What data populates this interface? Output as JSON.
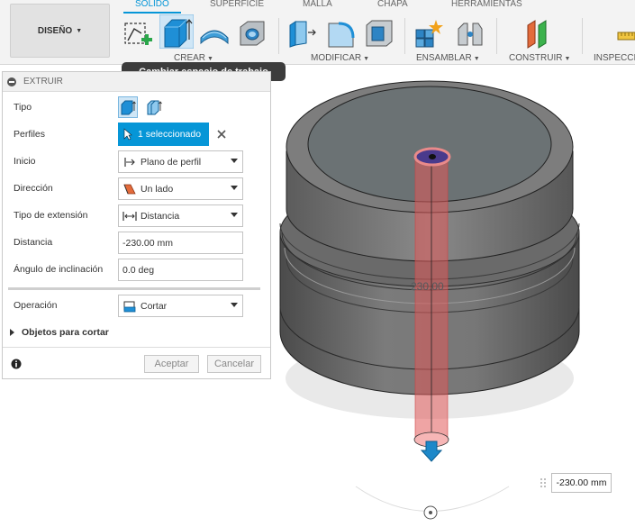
{
  "toolbar": {
    "workspace_label": "DISEÑO",
    "tabs": [
      "SÓLIDO",
      "SUPERFICIE",
      "MALLA",
      "CHAPA",
      "HERRAMIENTAS"
    ],
    "groups": {
      "create": "CREAR",
      "modify": "MODIFICAR",
      "assemble": "ENSAMBLAR",
      "construct": "CONSTRUIR",
      "inspect": "INSPECCIO"
    },
    "tooltip": "Cambiar espacio de trabajo"
  },
  "panel": {
    "title": "EXTRUIR",
    "fields": {
      "type_label": "Tipo",
      "profiles_label": "Perfiles",
      "profiles_value": "1 seleccionado",
      "start_label": "Inicio",
      "start_value": "Plano de perfil",
      "direction_label": "Dirección",
      "direction_value": "Un lado",
      "extent_label": "Tipo de extensión",
      "extent_value": "Distancia",
      "distance_label": "Distancia",
      "distance_value": "-230.00 mm",
      "taper_label": "Ángulo de inclinación",
      "taper_value": "0.0 deg",
      "operation_label": "Operación",
      "operation_value": "Cortar",
      "objects_to_cut": "Objetos para cortar"
    },
    "ok_label": "Aceptar",
    "cancel_label": "Cancelar"
  },
  "viewport": {
    "dimension_text": "230.00",
    "distance_input": "-230.00 mm"
  },
  "colors": {
    "accent": "#0696d7",
    "cut_body": "#e15a5a",
    "arrow": "#1d88c9"
  },
  "icons": [
    "caret-down-icon",
    "sketch-icon",
    "extrude-icon",
    "revolve-icon",
    "hole-icon",
    "press-pull-icon",
    "fillet-icon",
    "shell-icon",
    "new-component-icon",
    "joint-icon",
    "offset-plane-icon",
    "measure-icon",
    "info-icon",
    "close-icon"
  ]
}
